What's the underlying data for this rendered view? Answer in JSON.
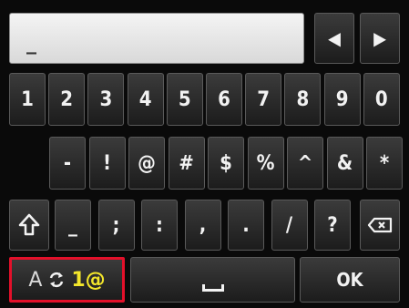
{
  "text_field": {
    "value": "_"
  },
  "cursor_buttons": {
    "left": "◀",
    "right": "▶"
  },
  "number_row": [
    "1",
    "2",
    "3",
    "4",
    "5",
    "6",
    "7",
    "8",
    "9",
    "0"
  ],
  "symbol_row1": [
    "-",
    "!",
    "@",
    "#",
    "$",
    "%",
    "^",
    "&",
    "*"
  ],
  "symbol_row2": [
    "_",
    ";",
    ":",
    ",",
    ".",
    "/",
    "?"
  ],
  "mode_key": {
    "alpha": "A",
    "num": "1@"
  },
  "ok_key": {
    "label": "OK"
  },
  "colors": {
    "highlight": "#e3102a",
    "numeric_mode": "#f3e62b"
  },
  "icons": {
    "shift": "shift-arrow-icon",
    "backspace": "backspace-icon",
    "mode_switch": "cycle-arrows-icon",
    "space": "space-bar-icon"
  }
}
